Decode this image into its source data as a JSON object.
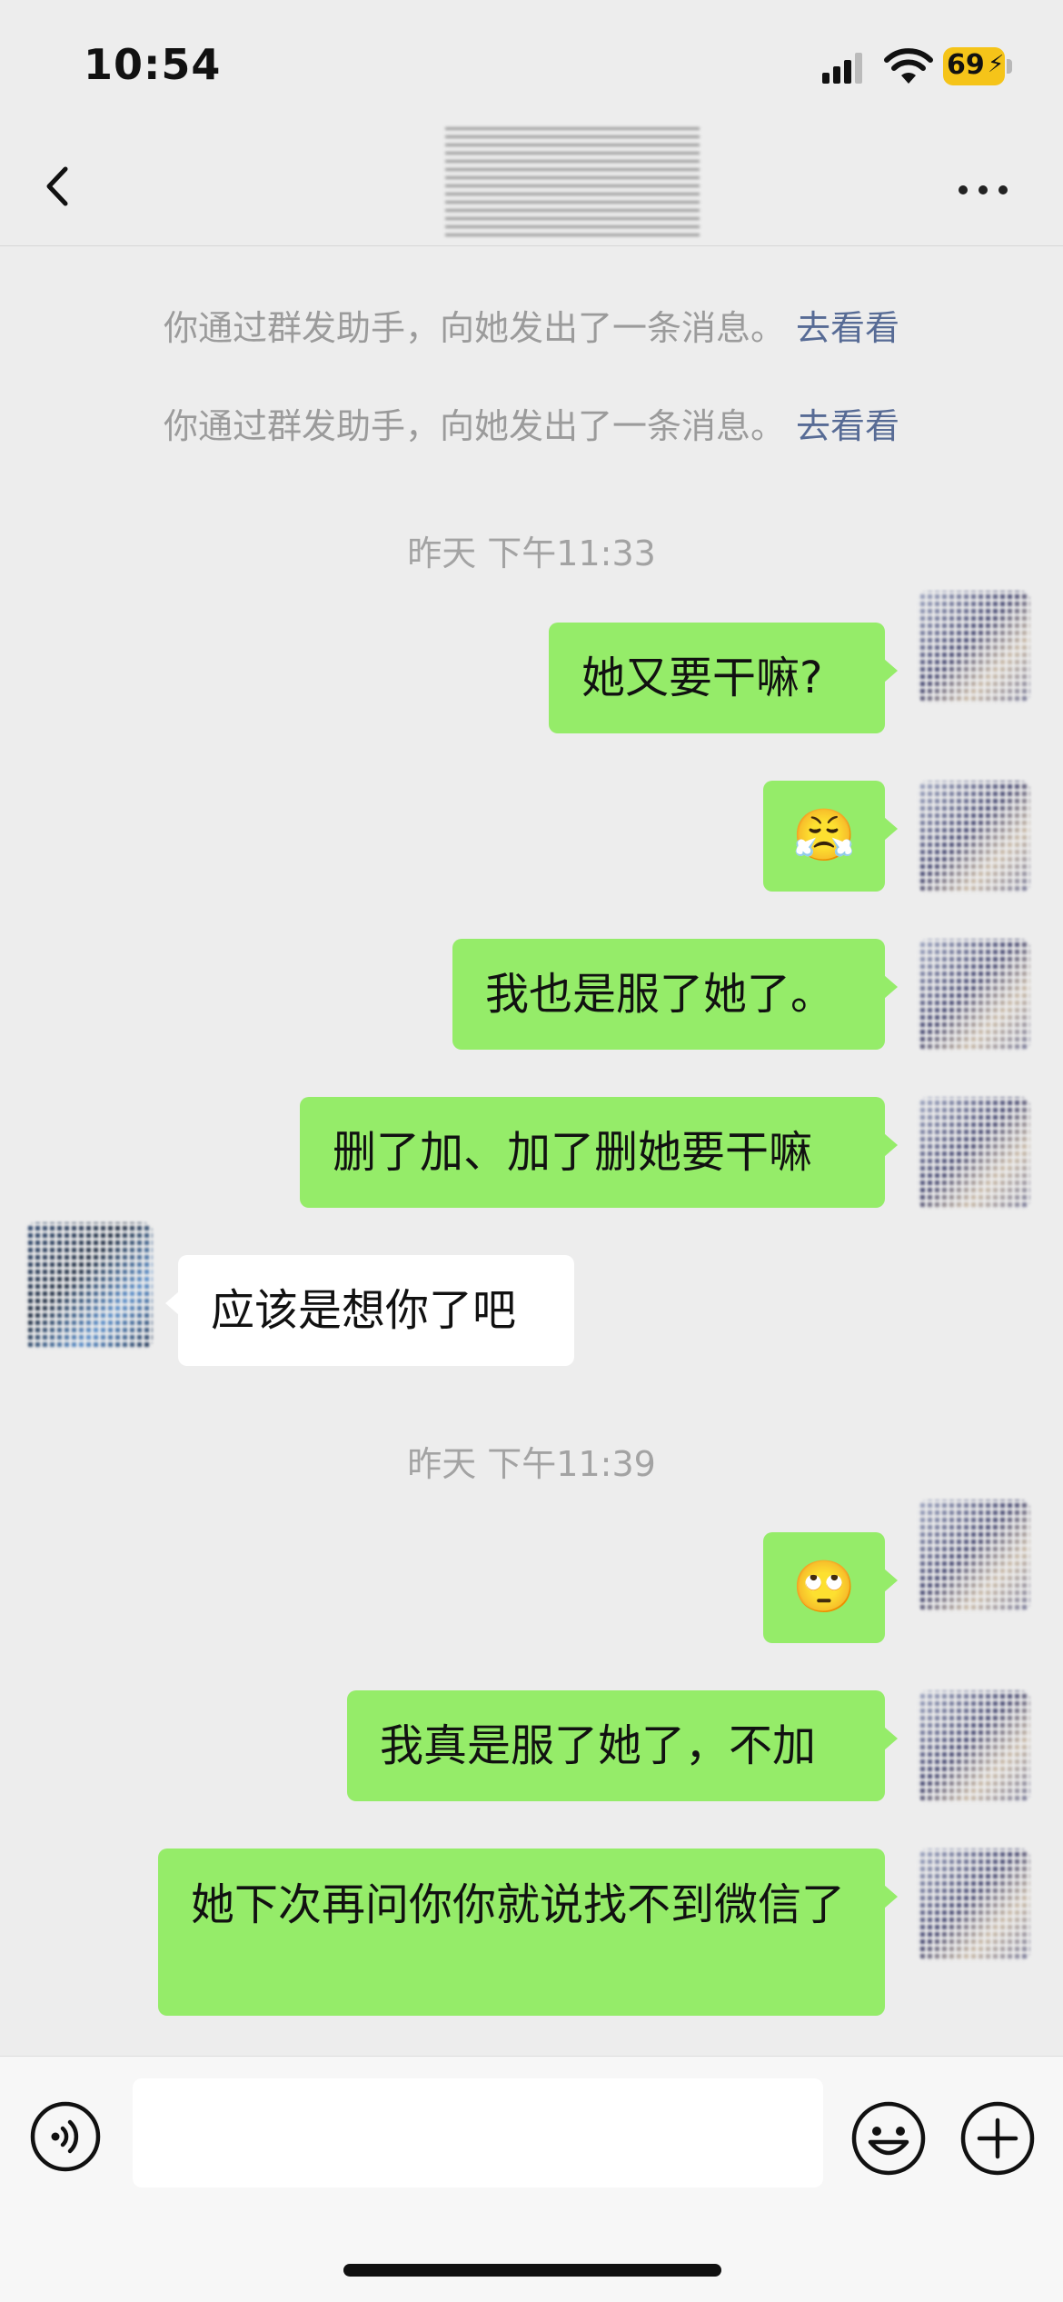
{
  "status_bar": {
    "time": "10:54",
    "battery": "69"
  },
  "nav": {
    "title": ""
  },
  "notices": [
    {
      "text": "你通过群发助手，向她发出了一条消息。",
      "link": "去看看"
    },
    {
      "text": "你通过群发助手，向她发出了一条消息。",
      "link": "去看看"
    }
  ],
  "timestamps": [
    "昨天 下午11:33",
    "昨天 下午11:39"
  ],
  "messages": [
    {
      "from": "me",
      "text": "她又要干嘛?"
    },
    {
      "from": "me",
      "text": "😤"
    },
    {
      "from": "me",
      "text": "我也是服了她了。"
    },
    {
      "from": "me",
      "text": "删了加、加了删她要干嘛"
    },
    {
      "from": "friend",
      "text": "应该是想你了吧"
    },
    {
      "from": "me",
      "text": "🙄"
    },
    {
      "from": "me",
      "text": "我真是服了她了，不加"
    },
    {
      "from": "me",
      "text": "她下次再问你你就说找不到微信了"
    }
  ],
  "input": {
    "value": "",
    "placeholder": ""
  },
  "icons": {
    "back": "chevron-left-icon",
    "more": "more-dots-icon",
    "voice": "voice-icon",
    "emoji": "emoji-icon",
    "plus": "plus-icon"
  },
  "colors": {
    "outgoing_bubble": "#95ec69",
    "incoming_bubble": "#ffffff",
    "link": "#576b95",
    "background": "#ededed"
  }
}
